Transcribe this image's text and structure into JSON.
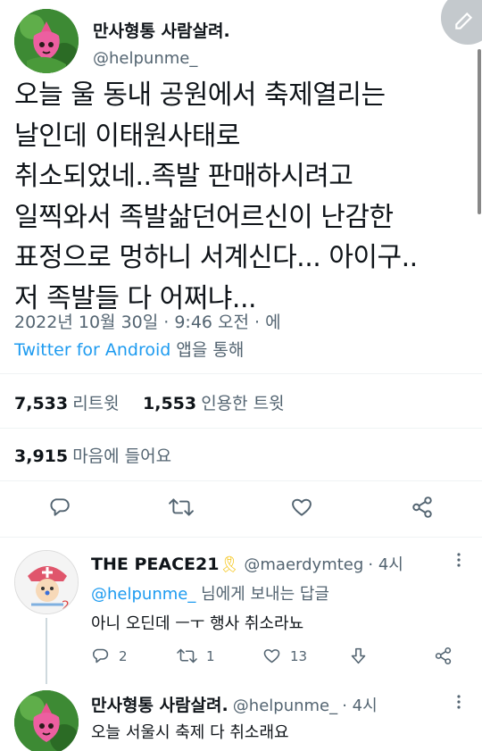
{
  "main_tweet": {
    "display_name": "만사형통 사람살려.",
    "handle": "@helpunme_",
    "text_lines": [
      "오늘 울 동내 공원에서 축제열리는",
      "날인데 이태원사태로",
      "취소되었네..족발 판매하시려고",
      "일찍와서 족발삶던어르신이 난감한",
      "표정으로 멍하니 서계신다... 아이구..",
      "저 족발들 다 어쩌냐..."
    ],
    "timestamp": "2022년 10월 30일 · 9:46 오전 · 에",
    "source_link": "Twitter for Android",
    "source_suffix": " 앱을 통해",
    "retweets_count": "7,533",
    "retweets_label": "리트윗",
    "quotes_count": "1,553",
    "quotes_label": "인용한 트윗",
    "likes_count": "3,915",
    "likes_label": "마음에 들어요"
  },
  "action_bar_icons": [
    "reply-icon",
    "retweet-icon",
    "like-icon",
    "share-icon"
  ],
  "reply_1": {
    "display_name": "THE PEACE21",
    "ribbon": "🎗",
    "handle": "@maerdymteg",
    "time": "· 4시",
    "replying_to": "@helpunme_",
    "replying_suffix": " 님에게 보내는 답글",
    "text": "아니 오딘데 ㅡㅜ 행사 취소라뇨",
    "reply_count": "2",
    "retweet_count": "1",
    "like_count": "13"
  },
  "reply_2": {
    "display_name": "만사형통 사람살려.",
    "handle": "@helpunme_",
    "time": "· 4시",
    "text": "오늘 서울시 축제 다 취소래요"
  },
  "colors": {
    "accent": "#1d9bf0",
    "text": "#0f1419",
    "secondary": "#536471",
    "divider": "#eff3f4"
  }
}
